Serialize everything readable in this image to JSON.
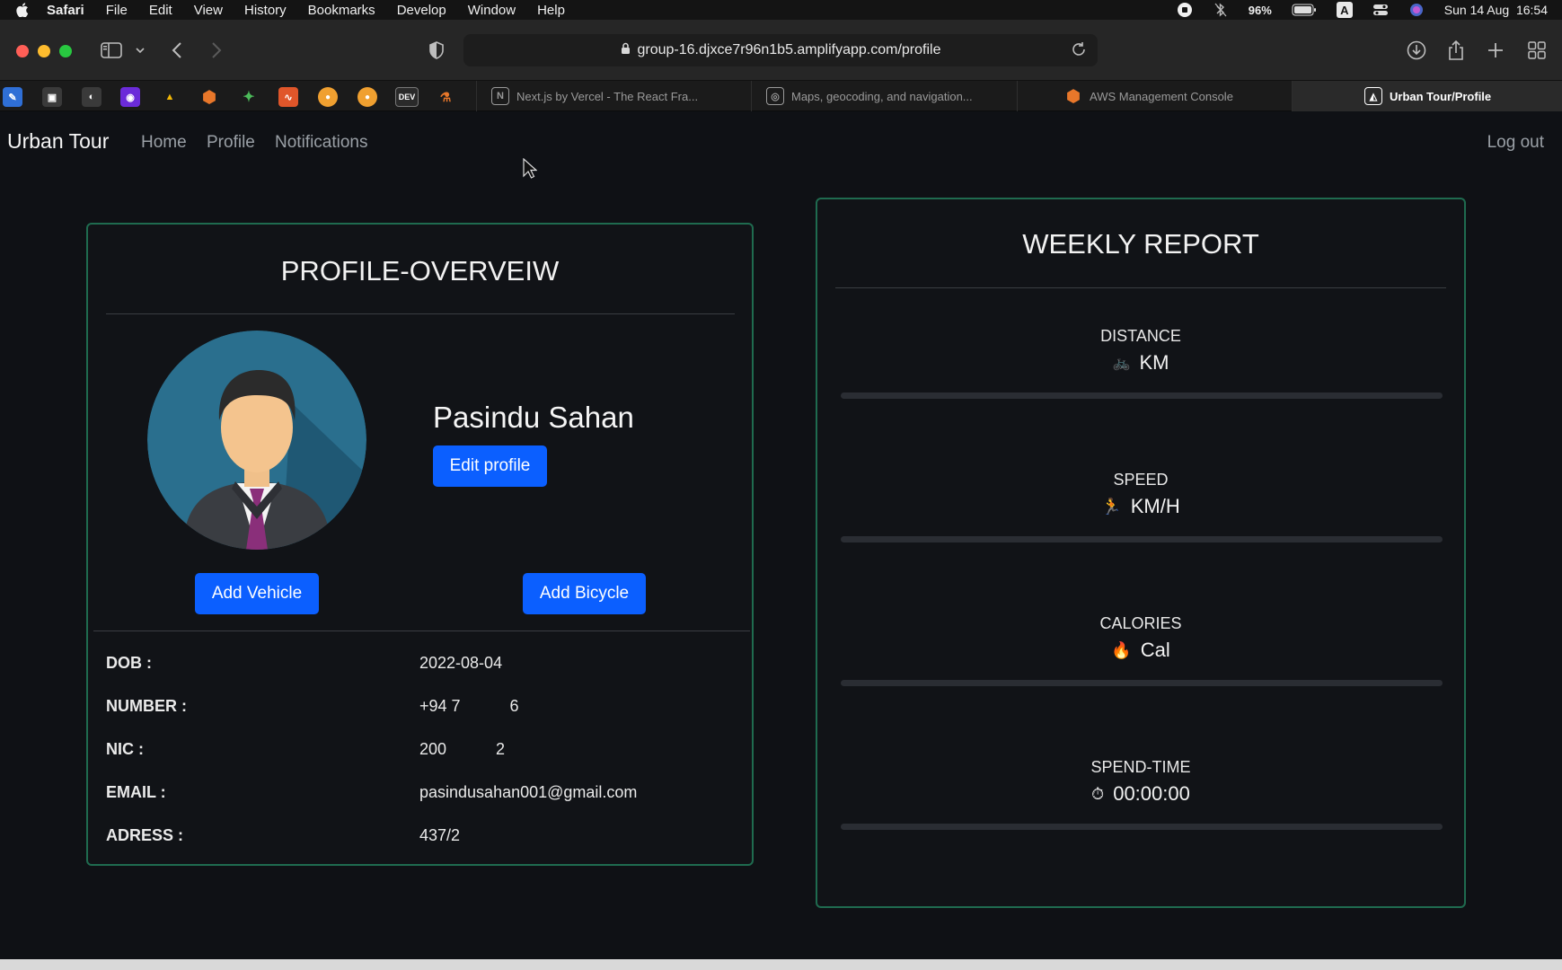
{
  "menubar": {
    "app_name": "Safari",
    "items": [
      "File",
      "Edit",
      "View",
      "History",
      "Bookmarks",
      "Develop",
      "Window",
      "Help"
    ],
    "battery": "96%",
    "input_source": "A",
    "datetime": "Sun 14 Aug  16:54"
  },
  "browser": {
    "url": "group-16.djxce7r96n1b5.amplifyapp.com/profile",
    "favorites": [
      {
        "name": "favorite-1",
        "color": "#2f6fd6",
        "glyph": "✎"
      },
      {
        "name": "favorite-2",
        "color": "#3a3a3a",
        "glyph": "▣"
      },
      {
        "name": "favorite-github",
        "color": "#3a3a3a",
        "glyph": "◐"
      },
      {
        "name": "favorite-4",
        "color": "#6b2bd9",
        "glyph": "◉"
      },
      {
        "name": "favorite-drive",
        "color": "#1b1b1b",
        "glyph": "▲"
      },
      {
        "name": "favorite-aws",
        "color": "#d9661a",
        "glyph": "⬢"
      },
      {
        "name": "favorite-7",
        "color": "#1b1b1b",
        "glyph": "✦"
      },
      {
        "name": "favorite-8",
        "color": "#e0562a",
        "glyph": "∿"
      },
      {
        "name": "favorite-9",
        "color": "#f0a030",
        "glyph": "●"
      },
      {
        "name": "favorite-10",
        "color": "#f0a030",
        "glyph": "●"
      },
      {
        "name": "favorite-dev",
        "color": "#2a2a2a",
        "glyph": "DEV"
      },
      {
        "name": "favorite-12",
        "color": "#1b1b1b",
        "glyph": "⚗"
      }
    ],
    "tabs": [
      {
        "title": "Next.js by Vercel - The React Fra...",
        "icon": "N"
      },
      {
        "title": "Maps, geocoding, and navigation...",
        "icon": "◎"
      },
      {
        "title": "AWS Management Console",
        "icon": "⬢"
      },
      {
        "title": "Urban Tour/Profile",
        "icon": "◭"
      }
    ]
  },
  "nav": {
    "brand": "Urban Tour",
    "links": [
      "Home",
      "Profile",
      "Notifications"
    ],
    "logout": "Log out"
  },
  "profile": {
    "title": "PROFILE-OVERVEIW",
    "name": "Pasindu Sahan",
    "edit_button": "Edit profile",
    "add_vehicle_button": "Add Vehicle",
    "add_bicycle_button": "Add Bicycle",
    "fields": [
      {
        "label": "DOB :",
        "value": "2022-08-04"
      },
      {
        "label": "NUMBER :",
        "value": "+94 7           6"
      },
      {
        "label": "NIC :",
        "value": "200           2"
      },
      {
        "label": "EMAIL :",
        "value": "pasindusahan001@gmail.com"
      },
      {
        "label": "ADRESS :",
        "value": "437/2"
      }
    ]
  },
  "report": {
    "title": "WEEKLY REPORT",
    "metrics": [
      {
        "label": "DISTANCE",
        "value": "KM",
        "icon": "bicycle-icon",
        "glyph": "🚲"
      },
      {
        "label": "SPEED",
        "value": "KM/H",
        "icon": "runner-icon",
        "glyph": "🏃"
      },
      {
        "label": "CALORIES",
        "value": "Cal",
        "icon": "fire-icon",
        "glyph": "🔥"
      },
      {
        "label": "SPEND-TIME",
        "value": "00:00:00",
        "icon": "stopwatch-icon",
        "glyph": "⏱"
      }
    ]
  }
}
